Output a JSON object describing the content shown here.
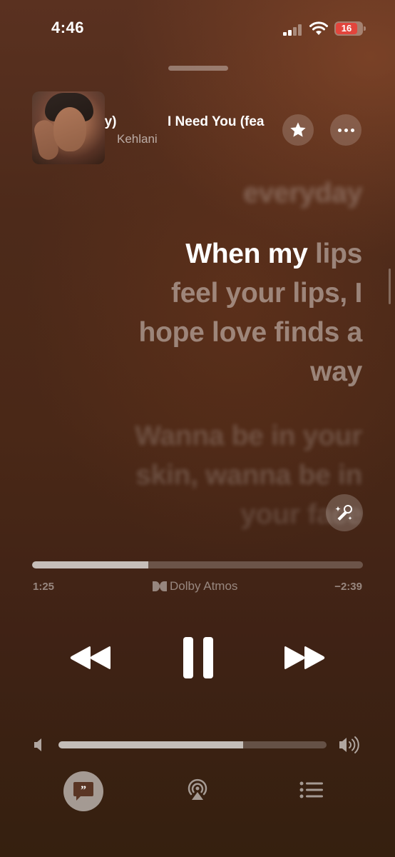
{
  "status_bar": {
    "time": "4:46",
    "battery_level": "16",
    "battery_color": "#e2453c"
  },
  "now_playing": {
    "title_fragment_left": "dy)",
    "title_fragment_right": "I Need You (fea",
    "artist": "Kehlani",
    "artwork_icon": "album-artwork"
  },
  "lyrics": {
    "previous_line": "everyday",
    "current_lines": [
      {
        "lit": "When my",
        "unlit": " lips"
      },
      {
        "lit": "",
        "unlit": "feel your lips, I"
      },
      {
        "lit": "",
        "unlit": "hope love finds a"
      },
      {
        "lit": "",
        "unlit": "way"
      }
    ],
    "next_lines": [
      "Wanna be in your",
      "skin, wanna be in",
      "your face"
    ]
  },
  "playback": {
    "progress_fraction": 0.352,
    "elapsed": "1:25",
    "remaining": "−2:39",
    "audio_format": "Dolby Atmos"
  },
  "volume": {
    "level_fraction": 0.69
  },
  "icons": {
    "star": "star-icon",
    "more": "more-icon",
    "singalong": "microphone-sparkle-icon",
    "rewind": "rewind-icon",
    "pause": "pause-icon",
    "forward": "fast-forward-icon",
    "lyrics": "lyrics-quote-icon",
    "airplay": "airplay-icon",
    "queue": "queue-list-icon"
  }
}
